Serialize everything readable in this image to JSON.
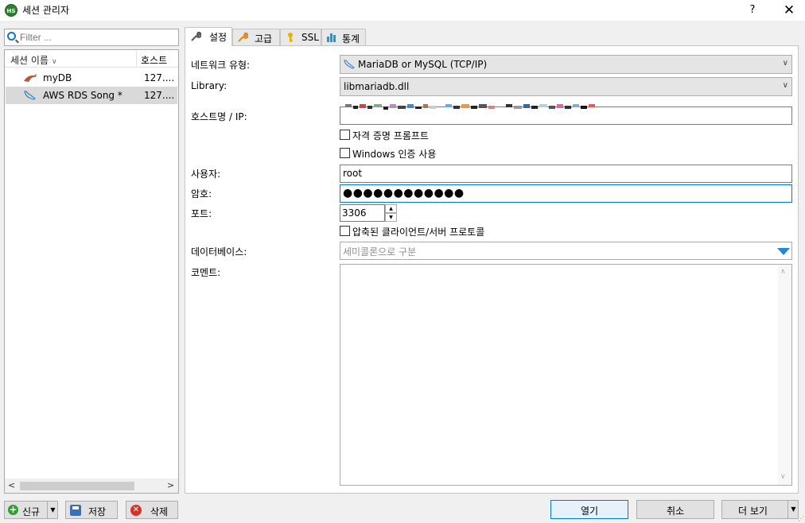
{
  "window": {
    "title": "세션 관리자",
    "icon_label": "HS",
    "help_label": "?",
    "close_label": "✕"
  },
  "filter": {
    "placeholder": "Filter ..."
  },
  "session_list": {
    "columns": [
      "세션 이름",
      "호스트"
    ],
    "rows": [
      {
        "name": "myDB",
        "host": "127....",
        "selected": false
      },
      {
        "name": "AWS RDS Song *",
        "host": "127....",
        "selected": true
      }
    ]
  },
  "left_buttons": {
    "new_label": "신규",
    "save_label": "저장",
    "delete_label": "삭제"
  },
  "tabs": [
    {
      "label": "설정",
      "icon": "wrench-icon",
      "active": true
    },
    {
      "label": "고급",
      "icon": "tools-icon",
      "active": false
    },
    {
      "label": "SSL",
      "icon": "key-icon",
      "active": false
    },
    {
      "label": "통계",
      "icon": "bar-chart-icon",
      "active": false
    }
  ],
  "settings": {
    "network_type_label": "네트워크 유형:",
    "network_type_value": "MariaDB or MySQL (TCP/IP)",
    "library_label": "Library:",
    "library_value": "libmariadb.dll",
    "host_label": "호스트명 / IP:",
    "prompt_credentials_label": "자격 증명 프롬프트",
    "windows_auth_label": "Windows 인증 사용",
    "user_label": "사용자:",
    "user_value": "root",
    "password_label": "암호:",
    "password_value": "●●●●●●●●●●●●",
    "port_label": "포트:",
    "port_value": "3306",
    "compressed_label": "압축된 클라이언트/서버 프로토콜",
    "database_label": "데이터베이스:",
    "database_placeholder": "세미콜론으로 구분",
    "comment_label": "코멘트:"
  },
  "bottom_buttons": {
    "open_label": "열기",
    "cancel_label": "취소",
    "more_label": "더 보기"
  },
  "colors": {
    "accent": "#0078d7",
    "dropdown_arrow": "#1e88e5"
  }
}
